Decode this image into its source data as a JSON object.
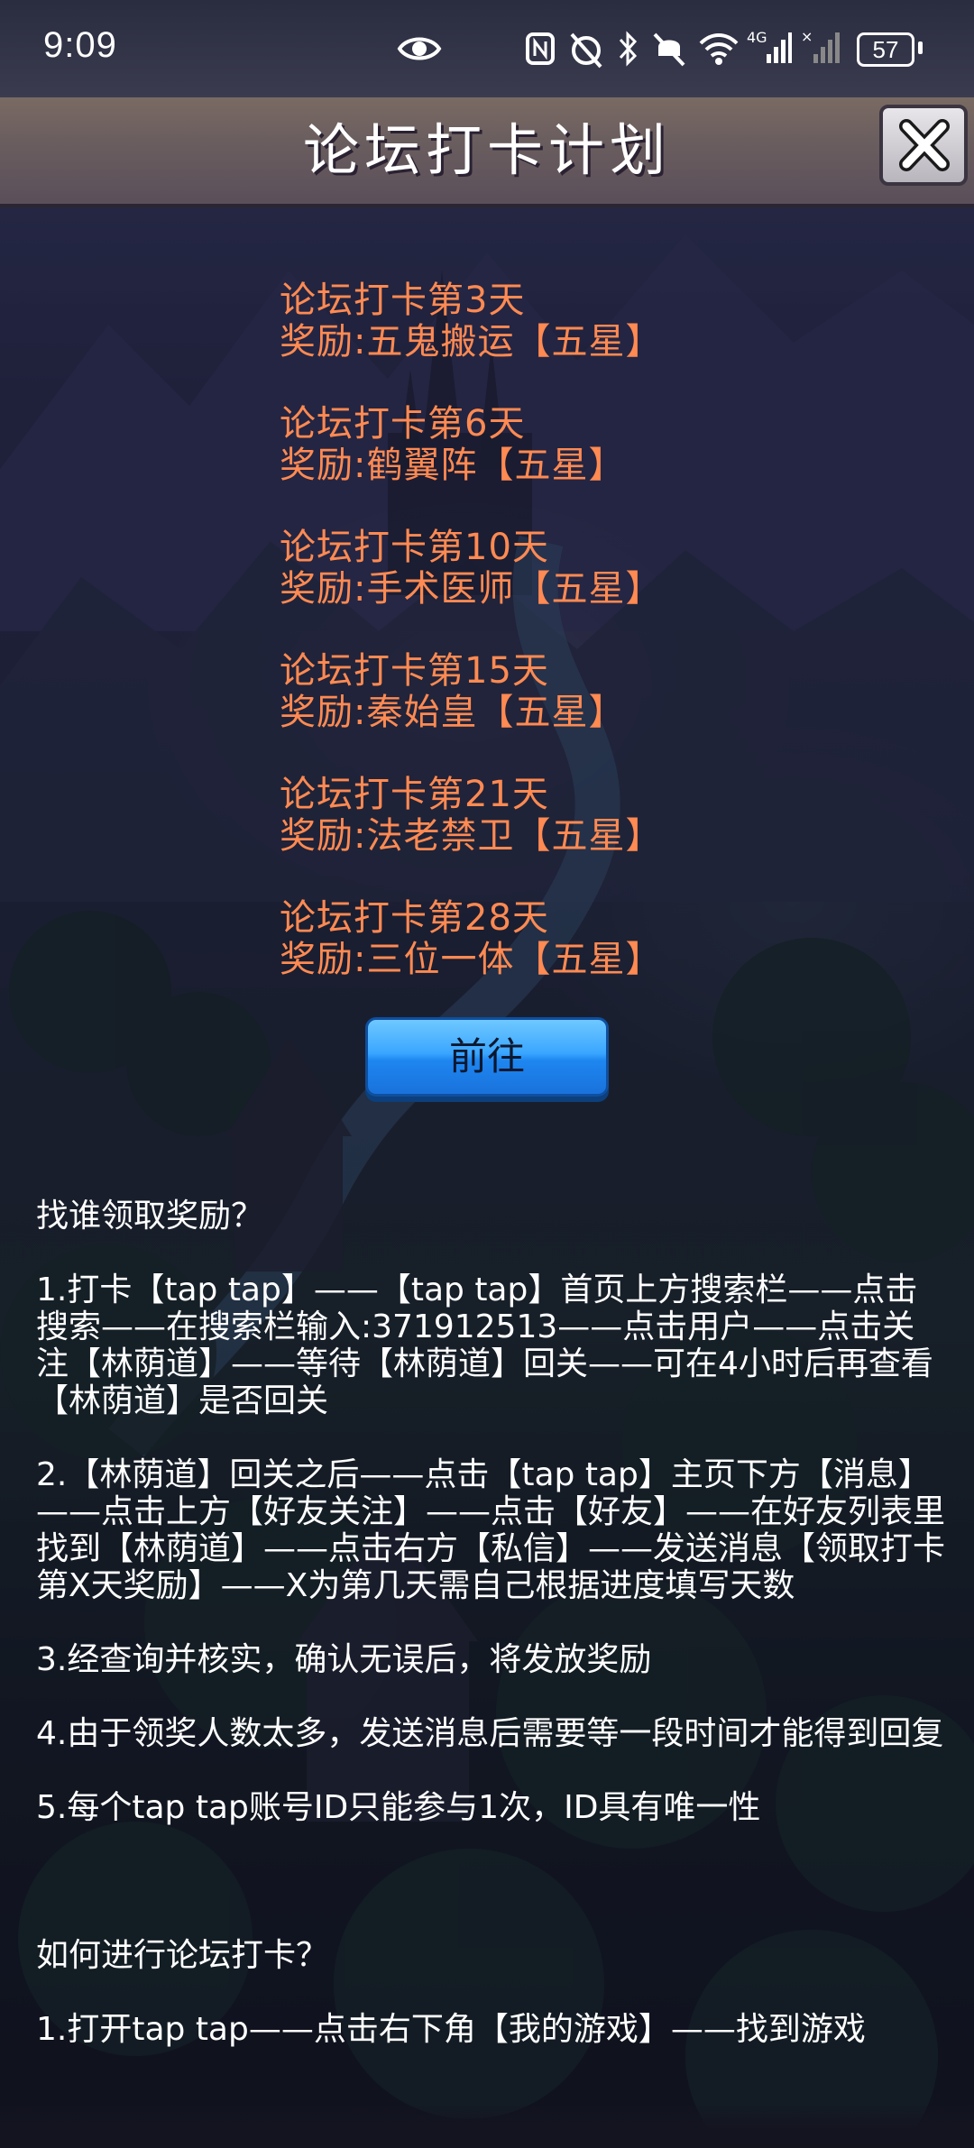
{
  "status_bar": {
    "time": "9:09",
    "signal_label": "4G",
    "battery": "57"
  },
  "header": {
    "title": "论坛打卡计划",
    "close_icon": "close-icon"
  },
  "rewards": [
    {
      "day_line": "论坛打卡第3天",
      "reward_line": "奖励:五鬼搬运【五星】"
    },
    {
      "day_line": "论坛打卡第6天",
      "reward_line": "奖励:鹤翼阵【五星】"
    },
    {
      "day_line": "论坛打卡第10天",
      "reward_line": "奖励:手术医师【五星】"
    },
    {
      "day_line": "论坛打卡第15天",
      "reward_line": "奖励:秦始皇【五星】"
    },
    {
      "day_line": "论坛打卡第21天",
      "reward_line": "奖励:法老禁卫【五星】"
    },
    {
      "day_line": "论坛打卡第28天",
      "reward_line": "奖励:三位一体【五星】"
    }
  ],
  "go_button_label": "前往",
  "instructions": {
    "who_title": "找谁领取奖励？",
    "step1": "1.打卡【tap tap】——【tap tap】首页上方搜索栏——点击搜索——在搜索栏输入:371912513——点击用户——点击关注【林荫道】——等待【林荫道】回关——可在4小时后再查看【林荫道】是否回关",
    "step2": "2.【林荫道】回关之后——点击【tap tap】主页下方【消息】——点击上方【好友关注】——点击【好友】——在好友列表里找到【林荫道】——点击右方【私信】——发送消息【领取打卡第X天奖励】——X为第几天需自己根据进度填写天数",
    "step3": "3.经查询并核实，确认无误后，将发放奖励",
    "step4": "4.由于领奖人数太多，发送消息后需要等一段时间才能得到回复",
    "step5": "5.每个tap tap账号ID只能参与1次，ID具有唯一性",
    "how_title": "如何进行论坛打卡？",
    "how_step1": "1.打开tap tap——点击右下角【我的游戏】——找到游戏"
  },
  "colors": {
    "reward_text": "#ff8a52",
    "button_blue": "#1e86f0",
    "header_bg": "#6b5e5f"
  }
}
